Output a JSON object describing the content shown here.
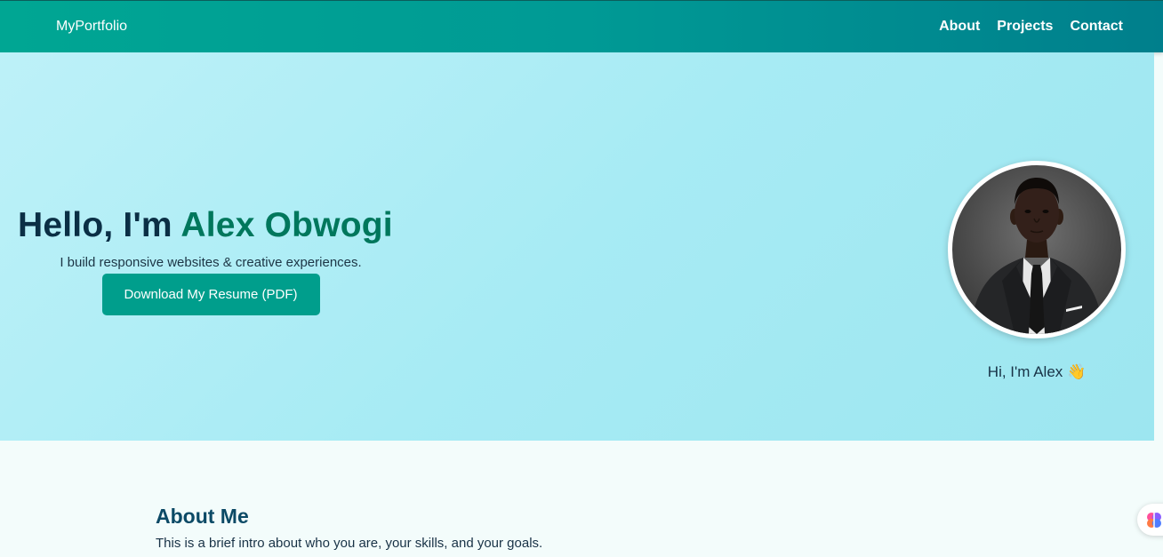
{
  "navbar": {
    "brand": "MyPortfolio",
    "links": [
      "About",
      "Projects",
      "Contact"
    ]
  },
  "hero": {
    "title_prefix": "Hello, I'm ",
    "title_name": "Alex Obwogi",
    "subtitle": "I build responsive websites & creative experiences.",
    "resume_button": "Download My Resume (PDF)"
  },
  "profile": {
    "greeting": "Hi, I'm Alex 👋",
    "photo_icon": "profile-photo"
  },
  "about": {
    "title": "About Me",
    "text": "This is a brief intro about who you are, your skills, and your goals."
  },
  "floating": {
    "icon": "brain-icon"
  },
  "colors": {
    "nav_gradient_start": "#00a693",
    "nav_gradient_end": "#007f8c",
    "hero_bg": "#b0eef6",
    "accent_name": "#00775c",
    "button_bg": "#009e8c",
    "heading_dark": "#0b2f45"
  }
}
